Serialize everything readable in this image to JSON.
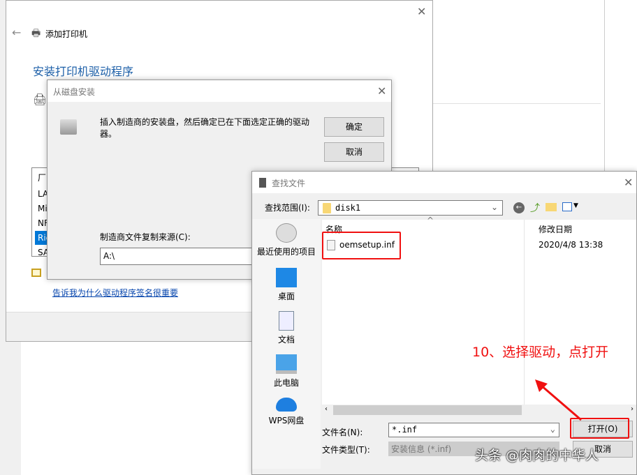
{
  "main_window": {
    "title": "添加打印机",
    "heading": "安装打印机驱动程序",
    "link": "告诉我为什么驱动程序签名很重要",
    "list_header": "厂",
    "list_items": [
      "LA",
      "Mi",
      "NF",
      "Ric",
      "SA"
    ],
    "selected_index": 3
  },
  "disk_dialog": {
    "title": "从磁盘安装",
    "message": "插入制造商的安装盘，然后确定已在下面选定正确的驱动器。",
    "ok": "确定",
    "cancel": "取消",
    "source_label": "制造商文件复制来源(C):",
    "source_value": "A:\\"
  },
  "find_dialog": {
    "title": "查找文件",
    "look_in_label": "查找范围(I):",
    "look_in_value": "disk1",
    "places": [
      {
        "label": "最近使用的项目",
        "icon": "recent-icon"
      },
      {
        "label": "桌面",
        "icon": "desktop-icon"
      },
      {
        "label": "文档",
        "icon": "documents-icon"
      },
      {
        "label": "此电脑",
        "icon": "computer-icon"
      },
      {
        "label": "WPS网盘",
        "icon": "cloud-icon"
      }
    ],
    "columns": {
      "name": "名称",
      "modified": "修改日期"
    },
    "files": [
      {
        "name": "oemsetup.inf",
        "modified": "2020/4/8 13:38"
      }
    ],
    "filename_label": "文件名(N):",
    "filename_value": "*.inf",
    "filetype_label": "文件类型(T):",
    "filetype_value": "安装信息 (*.inf)",
    "open": "打开(O)",
    "cancel": "取消"
  },
  "annotation": {
    "text": "10、选择驱动，点打开",
    "color": "#f01010"
  },
  "watermark": "头条 @肉肉的中华人"
}
